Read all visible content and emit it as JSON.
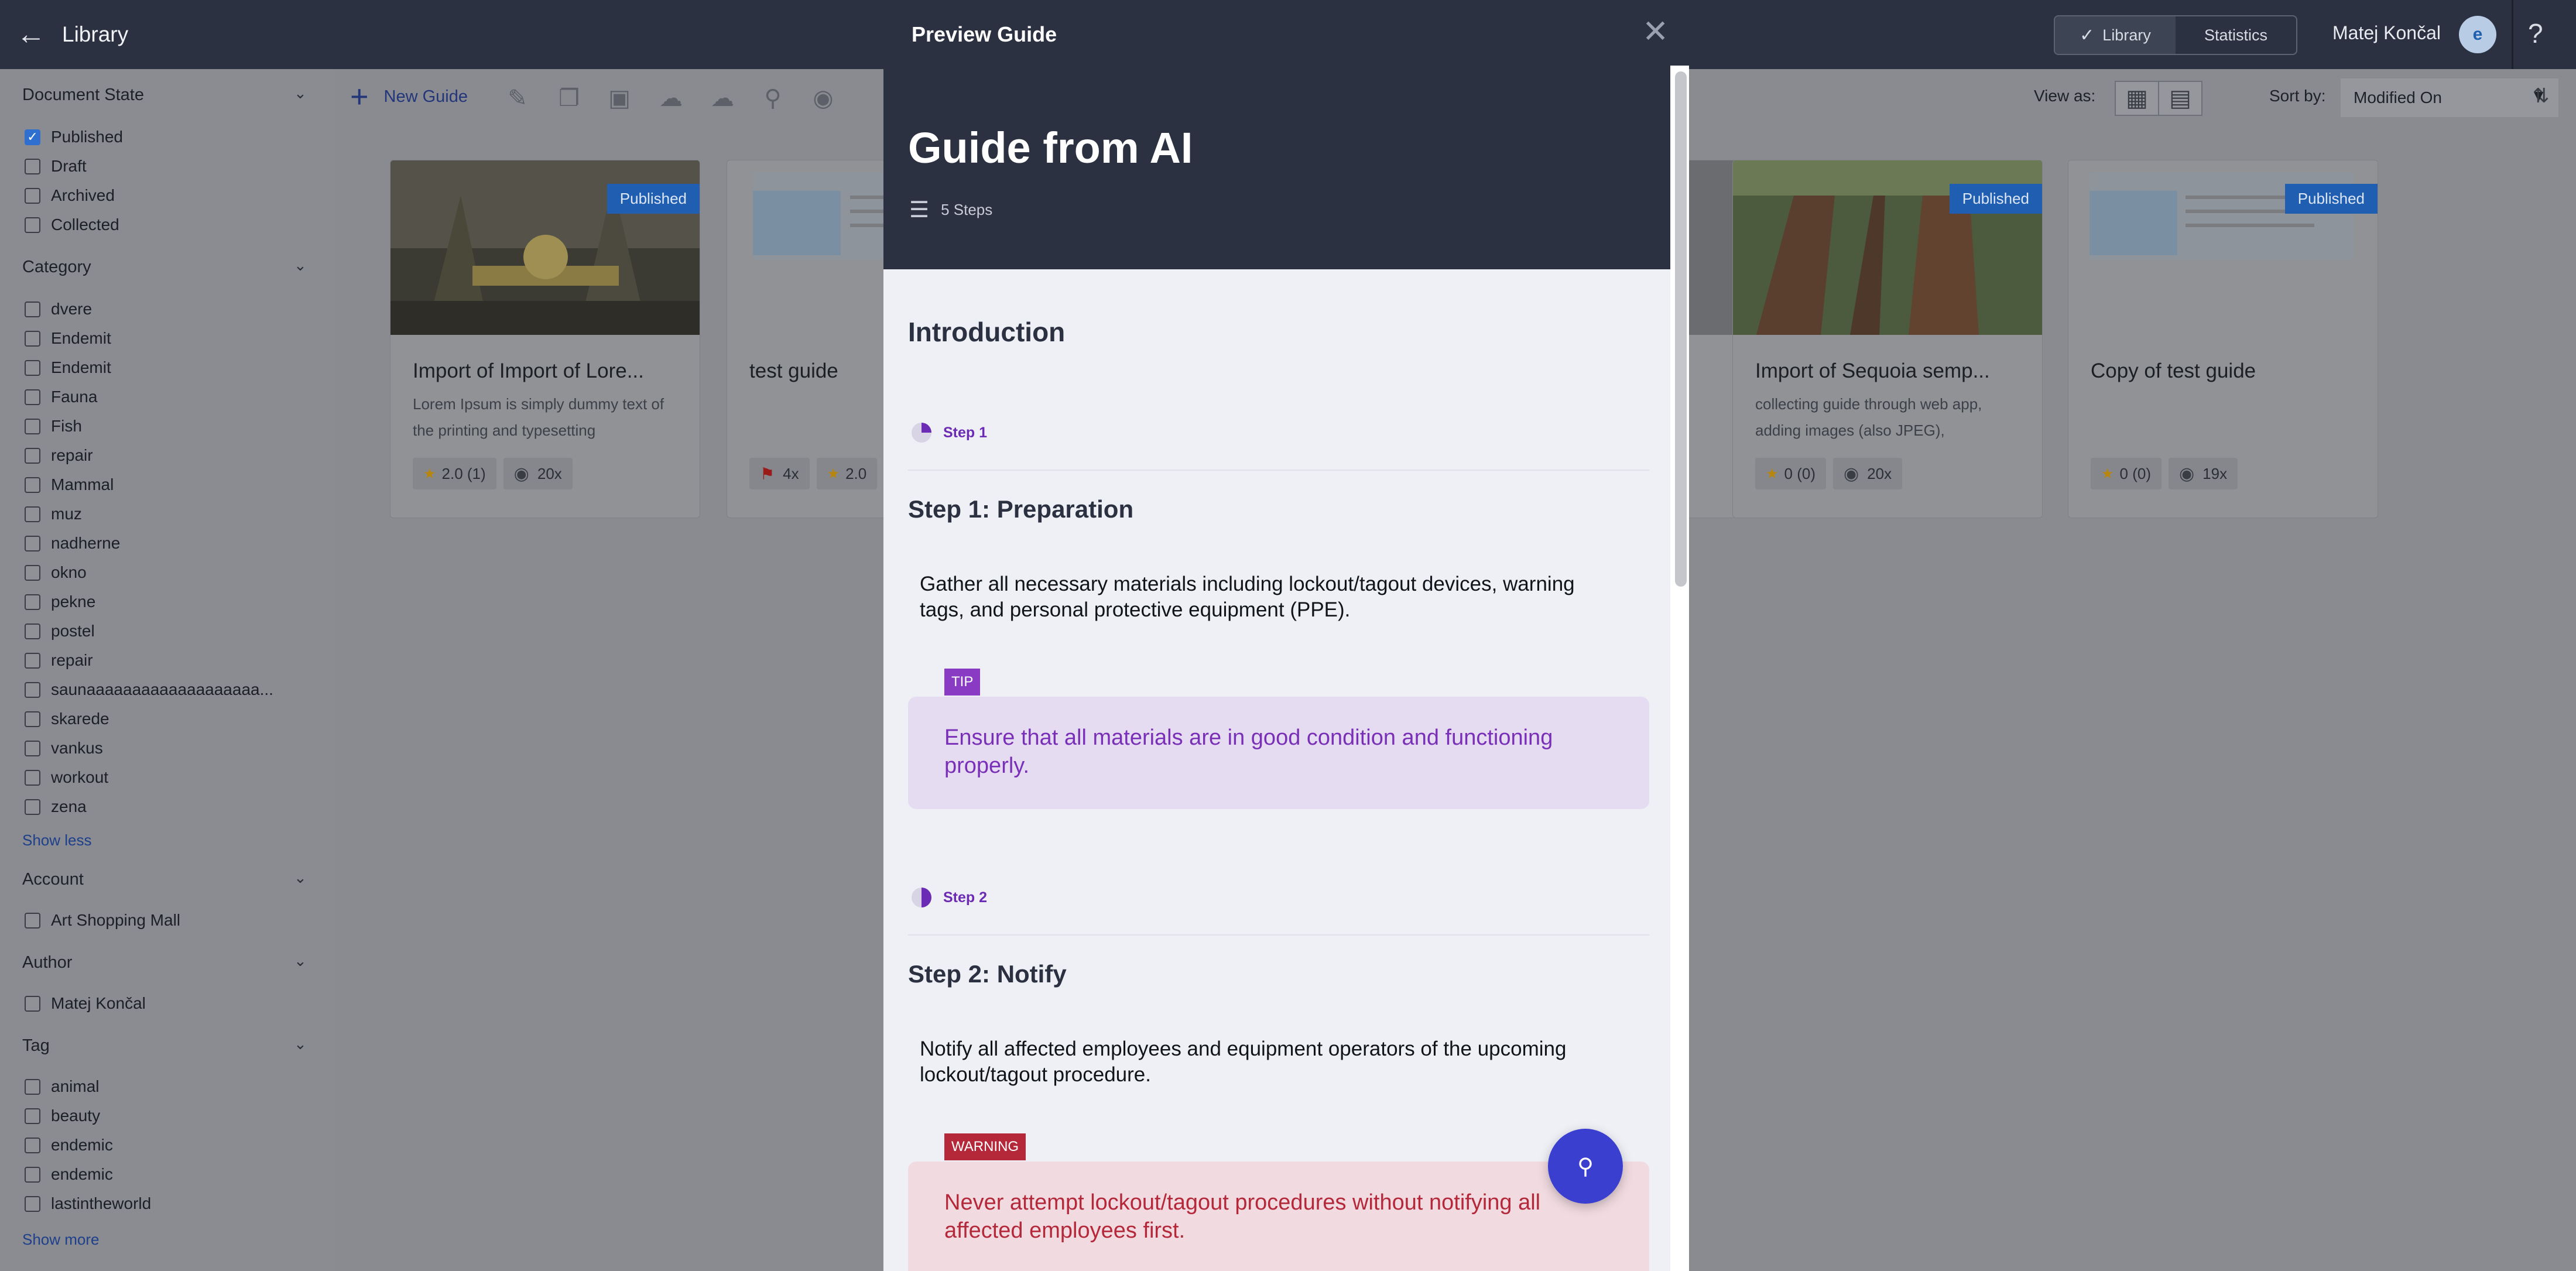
{
  "topbar": {
    "title": "Library",
    "tabs": [
      {
        "label": "Library",
        "active": true
      },
      {
        "label": "Statistics",
        "active": false
      }
    ],
    "user_name": "Matej Končal",
    "help": "?"
  },
  "sidebar": {
    "document_state": {
      "title": "Document State",
      "items": [
        {
          "label": "Published",
          "checked": true
        },
        {
          "label": "Draft",
          "checked": false
        },
        {
          "label": "Archived",
          "checked": false
        },
        {
          "label": "Collected",
          "checked": false
        }
      ]
    },
    "category": {
      "title": "Category",
      "items": [
        "dvere",
        "Endemit",
        "Endemit",
        "Fauna",
        "Fish",
        "repair",
        "Mammal",
        "muz",
        "nadherne",
        "okno",
        "pekne",
        "postel",
        "repair",
        "saunaaaaaaaaaaaaaaaaaaa...",
        "skarede",
        "vankus",
        "workout",
        "zena"
      ],
      "toggle": "Show less"
    },
    "account": {
      "title": "Account",
      "items": [
        "Art Shopping Mall"
      ]
    },
    "author": {
      "title": "Author",
      "items": [
        "Matej Končal"
      ]
    },
    "tag": {
      "title": "Tag",
      "items": [
        "animal",
        "beauty",
        "endemic",
        "endemic",
        "lastintheworld"
      ],
      "toggle": "Show more"
    }
  },
  "toolbar": {
    "new_guide": "New Guide",
    "view_as": "View as:",
    "sort_by": "Sort by:",
    "sort_value": "Modified On"
  },
  "cards": [
    {
      "title": "Import of Import of Lore...",
      "desc": "Lorem Ipsum is simply dummy text of the printing and typesetting",
      "badge": "Published",
      "rating": "2.0 (1)",
      "views": "20x"
    },
    {
      "title": "test guide",
      "desc": "",
      "badge": "",
      "flags": "4x",
      "rating": "2.0"
    },
    {
      "title": "Import of Sequoia semp...",
      "desc": "collecting guide through web app, adding images (also JPEG),",
      "badge": "Published",
      "rating": "0 (0)",
      "views": "20x"
    },
    {
      "title": "Copy of test guide",
      "desc": "",
      "badge": "Published",
      "rating": "0 (0)",
      "views": "19x"
    }
  ],
  "modal": {
    "header": "Preview Guide",
    "guide_title": "Guide from AI",
    "steps_count": "5 Steps",
    "intro": "Introduction",
    "step1": {
      "tag": "Step 1",
      "title": "Step 1: Preparation",
      "body": "Gather all necessary materials including lockout/tagout devices, warning tags, and personal protective equipment (PPE).",
      "callout_label": "TIP",
      "callout_text": "Ensure that all materials are in good condition and functioning properly."
    },
    "step2": {
      "tag": "Step 2",
      "title": "Step 2: Notify",
      "body": "Notify all affected employees and equipment operators of the upcoming lockout/tagout procedure.",
      "callout_label": "WARNING",
      "callout_text": "Never attempt lockout/tagout procedures without notifying all affected employees first."
    }
  },
  "colors": {
    "topbar_bg": "#2b3140",
    "tip_bg": "#e6dcf2",
    "tip_text": "#7a2fb8",
    "tip_label_bg": "#8a3bc4",
    "warning_bg": "#f1dbe1",
    "warning_text": "#b4283a",
    "warning_label_bg": "#b4283a",
    "fab": "#3b3fcf",
    "published_badge": "#1f5eb0"
  }
}
